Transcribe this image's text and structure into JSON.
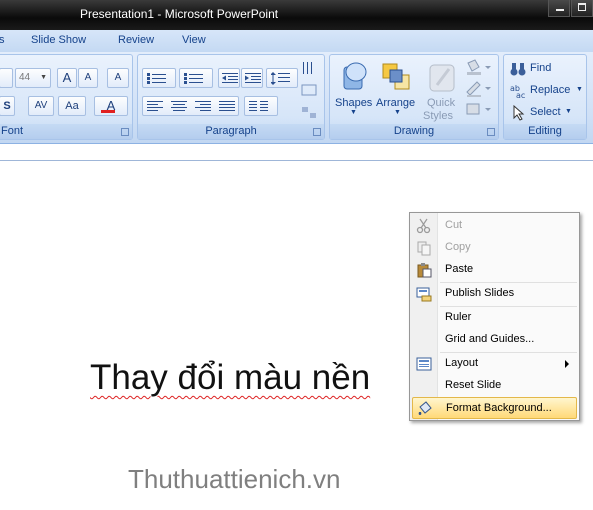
{
  "window": {
    "title": "Presentation1 - Microsoft PowerPoint"
  },
  "tabs": [
    "s",
    "Slide Show",
    "Review",
    "View"
  ],
  "ribbon": {
    "font_group": {
      "label": "Font",
      "size_value": "44",
      "aa_label": "Aa",
      "av_label": "AV"
    },
    "paragraph_group": {
      "label": "Paragraph"
    },
    "drawing_group": {
      "label": "Drawing",
      "shapes_label": "Shapes",
      "arrange_label": "Arrange",
      "quick_styles_label_1": "Quick",
      "quick_styles_label_2": "Styles"
    },
    "editing_group": {
      "label": "Editing",
      "find_label": "Find",
      "replace_label": "Replace",
      "select_label": "Select"
    }
  },
  "slide": {
    "title_text": "Thay đổi màu nền"
  },
  "watermark": "Thuthuattienich.vn",
  "context_menu": {
    "items": [
      {
        "label": "Cut",
        "enabled": false,
        "icon": "scissors-icon"
      },
      {
        "label": "Copy",
        "enabled": false,
        "icon": "copy-icon"
      },
      {
        "label": "Paste",
        "enabled": true,
        "icon": "clipboard-icon"
      },
      {
        "label": "Publish Slides",
        "enabled": true,
        "icon": "publish-icon"
      },
      {
        "label": "Ruler",
        "enabled": true,
        "icon": ""
      },
      {
        "label": "Grid and Guides...",
        "enabled": true,
        "icon": ""
      },
      {
        "label": "Layout",
        "enabled": true,
        "icon": "layout-icon",
        "submenu": true
      },
      {
        "label": "Reset Slide",
        "enabled": true,
        "icon": ""
      },
      {
        "label": "Format Background...",
        "enabled": true,
        "icon": "paint-bucket-icon",
        "highlighted": true
      }
    ]
  },
  "colors": {
    "ribbon_text": "#15428b",
    "highlight": "#ffd978",
    "spell_underline": "#dd2222"
  }
}
